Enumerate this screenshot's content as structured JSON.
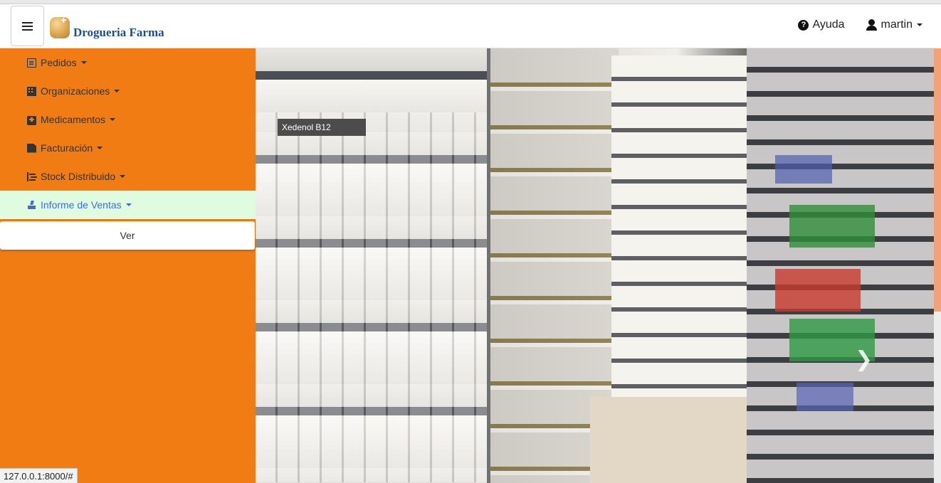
{
  "navbar": {
    "brand_name": "Drogueria Farma",
    "help_label": "Ayuda",
    "user_label": "martin"
  },
  "sidebar": {
    "items": [
      {
        "label": "Pedidos",
        "icon": "list-doc-icon"
      },
      {
        "label": "Organizaciones",
        "icon": "building-icon"
      },
      {
        "label": "Medicamentos",
        "icon": "medkit-icon"
      },
      {
        "label": "Facturación",
        "icon": "file-icon"
      },
      {
        "label": "Stock Distribuido",
        "icon": "tree-icon"
      },
      {
        "label": "Informe de Ventas",
        "icon": "report-icon",
        "active": true
      }
    ],
    "submenu_item": "Ver"
  },
  "hero": {
    "box_text": "Xedenol B12"
  },
  "statusbar": {
    "url": "127.0.0.1:8000/#"
  },
  "colors": {
    "sidebar_bg": "#f27c14",
    "active_bg": "#e0fce0",
    "active_text": "#3c6fd4",
    "brand_blue": "#1e4f8d"
  }
}
